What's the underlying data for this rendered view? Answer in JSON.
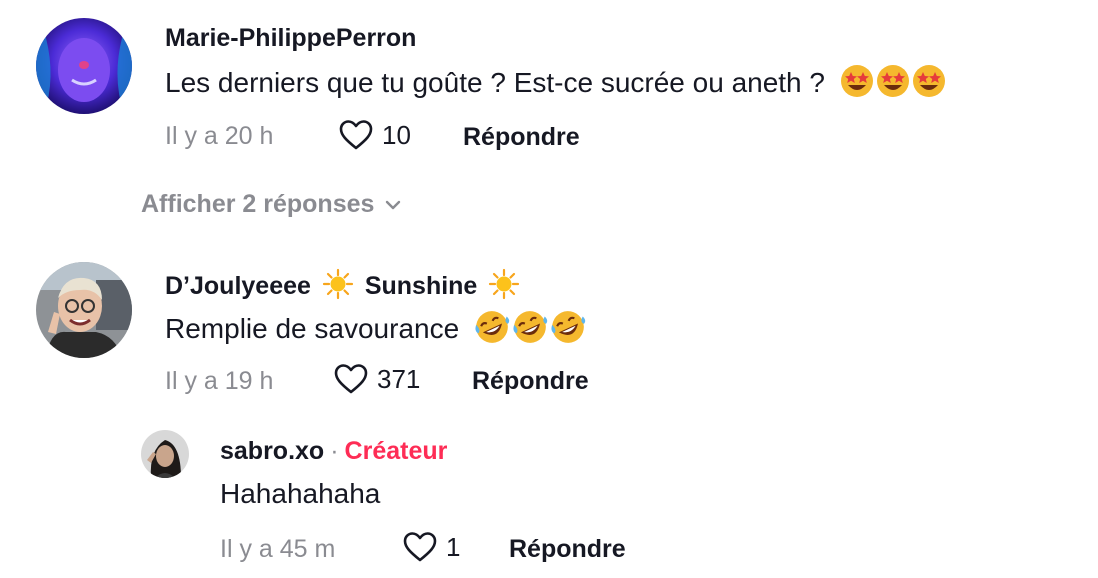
{
  "comments": [
    {
      "username": "Marie-PhilippePerron",
      "text": "Les derniers que tu goûte ? Est-ce sucrée ou aneth ?",
      "emojis": [
        "star-struck-icon",
        "star-struck-icon",
        "star-struck-icon"
      ],
      "time": "Il y a 20 h",
      "likes": "10",
      "reply_label": "Répondre"
    },
    {
      "username_part1": "D’Joulyeeee",
      "username_part2": "Sunshine",
      "text": "Remplie de savourance",
      "emojis": [
        "rofl-icon",
        "rofl-icon",
        "rofl-icon"
      ],
      "time": "Il y a 19 h",
      "likes": "371",
      "reply_label": "Répondre"
    }
  ],
  "view_replies": "Afficher 2 réponses",
  "reply": {
    "username": "sabro.xo",
    "separator": "·",
    "badge": "Créateur",
    "text": "Hahahahaha",
    "time": "Il y a 45 m",
    "likes": "1",
    "reply_label": "Répondre"
  },
  "colors": {
    "creator": "#fe2c55",
    "muted": "#8a8b91",
    "text": "#161823"
  }
}
